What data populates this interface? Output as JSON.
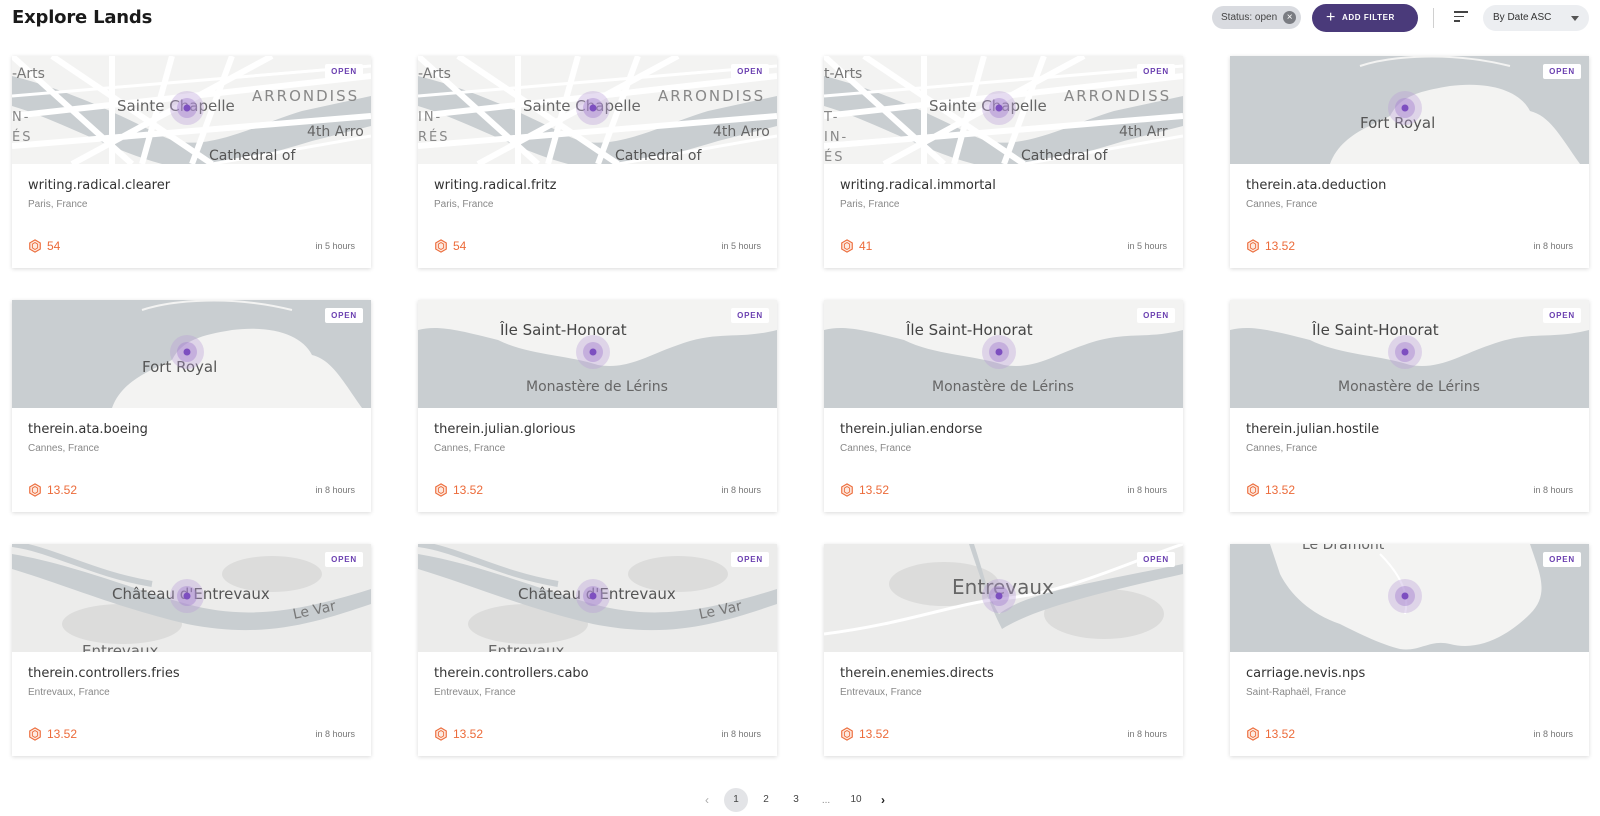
{
  "header": {
    "title": "Explore Lands",
    "filter_chip": "Status: open",
    "add_filter_label": "ADD FILTER",
    "sort_select": "By Date ASC"
  },
  "colors": {
    "accent": "#4a3a7a",
    "price": "#ec6b3a",
    "badge_text": "#6a3fb0",
    "marker": "#7d4fc0"
  },
  "cards": [
    {
      "name": "writing.radical.clearer",
      "location": "Paris, France",
      "price": "54",
      "time": "in 5 hours",
      "status": "OPEN",
      "map": "paris",
      "map_labels": [
        "Sainte Chapelle",
        "ARRONDISS",
        "4th Arro",
        "Cathedral of",
        "-Arts",
        "N-",
        "ÉS"
      ]
    },
    {
      "name": "writing.radical.fritz",
      "location": "Paris, France",
      "price": "54",
      "time": "in 5 hours",
      "status": "OPEN",
      "map": "paris",
      "map_labels": [
        "Sainte Chapelle",
        "ARRONDISS",
        "4th Arro",
        "Cathedral of",
        "-Arts",
        "IN-",
        "RÉS"
      ]
    },
    {
      "name": "writing.radical.immortal",
      "location": "Paris, France",
      "price": "41",
      "time": "in 5 hours",
      "status": "OPEN",
      "map": "paris",
      "map_labels": [
        "Sainte Chapelle",
        "ARRONDISS",
        "4th Arr",
        "Cathedral of",
        "t-Arts",
        "T-",
        "IN-",
        "ÉS"
      ]
    },
    {
      "name": "therein.ata.deduction",
      "location": "Cannes, France",
      "price": "13.52",
      "time": "in 8 hours",
      "status": "OPEN",
      "map": "fort",
      "map_labels": [
        "Fort Royal"
      ]
    },
    {
      "name": "therein.ata.boeing",
      "location": "Cannes, France",
      "price": "13.52",
      "time": "in 8 hours",
      "status": "OPEN",
      "map": "fort",
      "map_labels": [
        "Fort Royal"
      ]
    },
    {
      "name": "therein.julian.glorious",
      "location": "Cannes, France",
      "price": "13.52",
      "time": "in 8 hours",
      "status": "OPEN",
      "map": "honorat",
      "map_labels": [
        "Île Saint-Honorat",
        "Monastère de Lérins"
      ]
    },
    {
      "name": "therein.julian.endorse",
      "location": "Cannes, France",
      "price": "13.52",
      "time": "in 8 hours",
      "status": "OPEN",
      "map": "honorat",
      "map_labels": [
        "Île Saint-Honorat",
        "Monastère de Lérins"
      ]
    },
    {
      "name": "therein.julian.hostile",
      "location": "Cannes, France",
      "price": "13.52",
      "time": "in 8 hours",
      "status": "OPEN",
      "map": "honorat",
      "map_labels": [
        "Île Saint-Honorat",
        "Monastère de Lérins"
      ]
    },
    {
      "name": "therein.controllers.fries",
      "location": "Entrevaux, France",
      "price": "13.52",
      "time": "in 8 hours",
      "status": "OPEN",
      "map": "chateau",
      "map_labels": [
        "Château d'Entrevaux",
        "Le Var",
        "Entrevaux"
      ]
    },
    {
      "name": "therein.controllers.cabo",
      "location": "Entrevaux, France",
      "price": "13.52",
      "time": "in 8 hours",
      "status": "OPEN",
      "map": "chateau",
      "map_labels": [
        "Château d'Entrevaux",
        "Le Var",
        "Entrevaux"
      ]
    },
    {
      "name": "therein.enemies.directs",
      "location": "Entrevaux, France",
      "price": "13.52",
      "time": "in 8 hours",
      "status": "OPEN",
      "map": "entrevaux",
      "map_labels": [
        "Entrevaux"
      ]
    },
    {
      "name": "carriage.nevis.nps",
      "location": "Saint-Raphaël, France",
      "price": "13.52",
      "time": "in 8 hours",
      "status": "OPEN",
      "map": "dramont",
      "map_labels": [
        "Le Dramont"
      ]
    }
  ],
  "pagination": {
    "pages": [
      "1",
      "2",
      "3",
      "...",
      "10"
    ],
    "current": "1",
    "prev_icon": "chevron-left-icon",
    "next_icon": "chevron-right-icon"
  }
}
